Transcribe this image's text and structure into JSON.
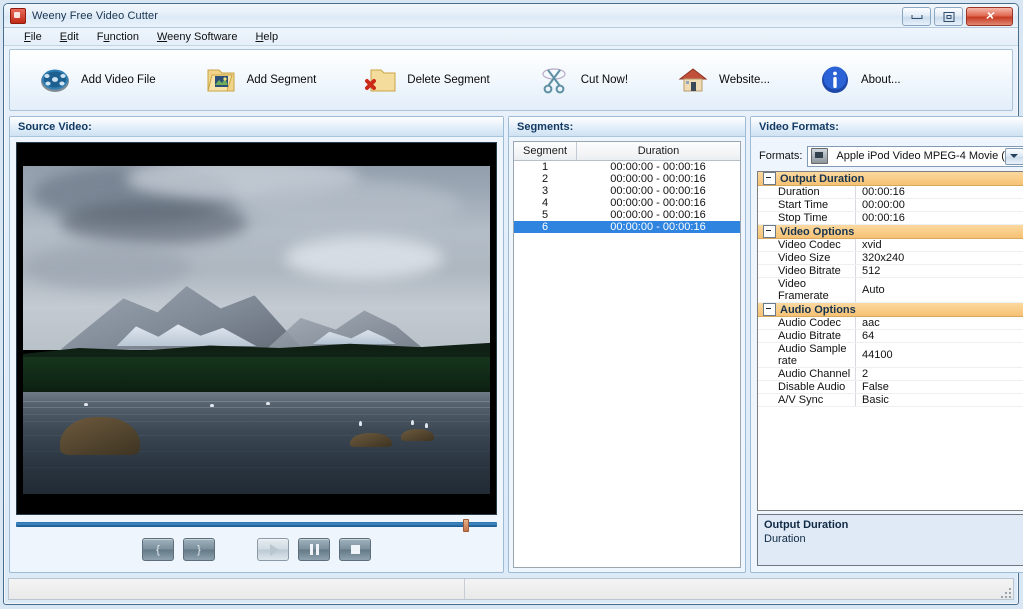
{
  "window": {
    "title": "Weeny Free Video Cutter",
    "icon": "app-icon",
    "minimize_label": "",
    "maximize_label": "",
    "close_label": "✕"
  },
  "menu": {
    "items": [
      {
        "label": "File",
        "accel": "F"
      },
      {
        "label": "Edit",
        "accel": "E"
      },
      {
        "label": "Function",
        "accel": "u"
      },
      {
        "label": "Weeny Software",
        "accel": "W"
      },
      {
        "label": "Help",
        "accel": "H"
      }
    ]
  },
  "toolbar": {
    "buttons": [
      {
        "label": "Add Video File",
        "icon": "film-reel-icon"
      },
      {
        "label": "Add Segment",
        "icon": "folder-image-icon"
      },
      {
        "label": "Delete Segment",
        "icon": "folder-delete-icon"
      },
      {
        "label": "Cut Now!",
        "icon": "scissors-icon"
      },
      {
        "label": "Website...",
        "icon": "house-icon"
      },
      {
        "label": "About...",
        "icon": "info-icon"
      }
    ]
  },
  "source_panel": {
    "title": "Source Video:",
    "seek": {
      "position_percent": 93
    },
    "controls": [
      {
        "name": "mark-in-button",
        "label": "{"
      },
      {
        "name": "mark-out-button",
        "label": "}"
      },
      {
        "name": "play-button",
        "label": ""
      },
      {
        "name": "pause-button",
        "label": ""
      },
      {
        "name": "stop-button",
        "label": ""
      }
    ]
  },
  "segments_panel": {
    "title": "Segments:",
    "columns": [
      "Segment",
      "Duration"
    ],
    "rows": [
      {
        "segment": "1",
        "duration": "00:00:00 - 00:00:16",
        "selected": false
      },
      {
        "segment": "2",
        "duration": "00:00:00 - 00:00:16",
        "selected": false
      },
      {
        "segment": "3",
        "duration": "00:00:00 - 00:00:16",
        "selected": false
      },
      {
        "segment": "4",
        "duration": "00:00:00 - 00:00:16",
        "selected": false
      },
      {
        "segment": "5",
        "duration": "00:00:00 - 00:00:16",
        "selected": false
      },
      {
        "segment": "6",
        "duration": "00:00:00 - 00:00:16",
        "selected": true
      }
    ]
  },
  "formats_panel": {
    "title": "Video Formats:",
    "formats_label": "Formats:",
    "format_selected": "Apple iPod Video MPEG-4 Movie (",
    "categories": [
      {
        "name": "Output Duration",
        "rows": [
          {
            "name": "Duration",
            "value": "00:00:16"
          },
          {
            "name": "Start Time",
            "value": "00:00:00"
          },
          {
            "name": "Stop Time",
            "value": "00:00:16"
          }
        ]
      },
      {
        "name": "Video Options",
        "rows": [
          {
            "name": "Video Codec",
            "value": "xvid"
          },
          {
            "name": "Video Size",
            "value": "320x240"
          },
          {
            "name": "Video Bitrate",
            "value": "512"
          },
          {
            "name": "Video Framerate",
            "value": "Auto"
          }
        ]
      },
      {
        "name": "Audio Options",
        "rows": [
          {
            "name": "Audio Codec",
            "value": "aac"
          },
          {
            "name": "Audio Bitrate",
            "value": "64"
          },
          {
            "name": "Audio Sample rate",
            "value": "44100"
          },
          {
            "name": "Audio Channel",
            "value": "2"
          },
          {
            "name": "Disable Audio",
            "value": "False"
          },
          {
            "name": "A/V Sync",
            "value": "Basic"
          }
        ]
      }
    ],
    "description": {
      "title": "Output Duration",
      "body": "Duration"
    }
  },
  "status_bar": {
    "left_text": "",
    "right_text": ""
  },
  "colors": {
    "selection_blue": "#2f84e0",
    "header_navy": "#123a63",
    "category_orange": "#f6c173",
    "seek_track": "#3f8ecb",
    "seek_thumb": "#c4744a"
  }
}
